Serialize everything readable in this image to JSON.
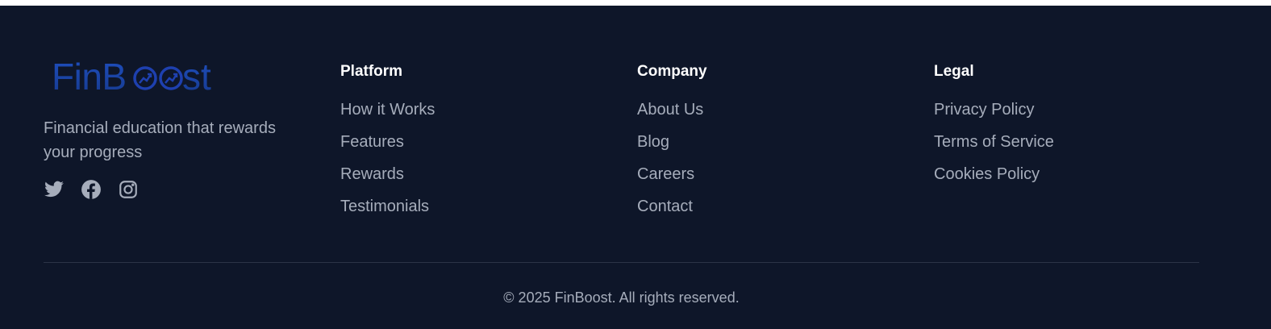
{
  "brand": {
    "logo_text": "FinBoost",
    "logo_color": "#1e40af",
    "tagline": "Financial education that rewards your progress"
  },
  "socials": [
    {
      "icon": "twitter-icon",
      "name": "Twitter"
    },
    {
      "icon": "facebook-icon",
      "name": "Facebook"
    },
    {
      "icon": "instagram-icon",
      "name": "Instagram"
    }
  ],
  "columns": [
    {
      "heading": "Platform",
      "links": [
        "How it Works",
        "Features",
        "Rewards",
        "Testimonials"
      ]
    },
    {
      "heading": "Company",
      "links": [
        "About Us",
        "Blog",
        "Careers",
        "Contact"
      ]
    },
    {
      "heading": "Legal",
      "links": [
        "Privacy Policy",
        "Terms of Service",
        "Cookies Policy"
      ]
    }
  ],
  "copyright": "© 2025 FinBoost. All rights reserved.",
  "colors": {
    "background": "#0e1629",
    "heading": "#ffffff",
    "muted_text": "#a6adbb",
    "divider": "#2c3446"
  }
}
